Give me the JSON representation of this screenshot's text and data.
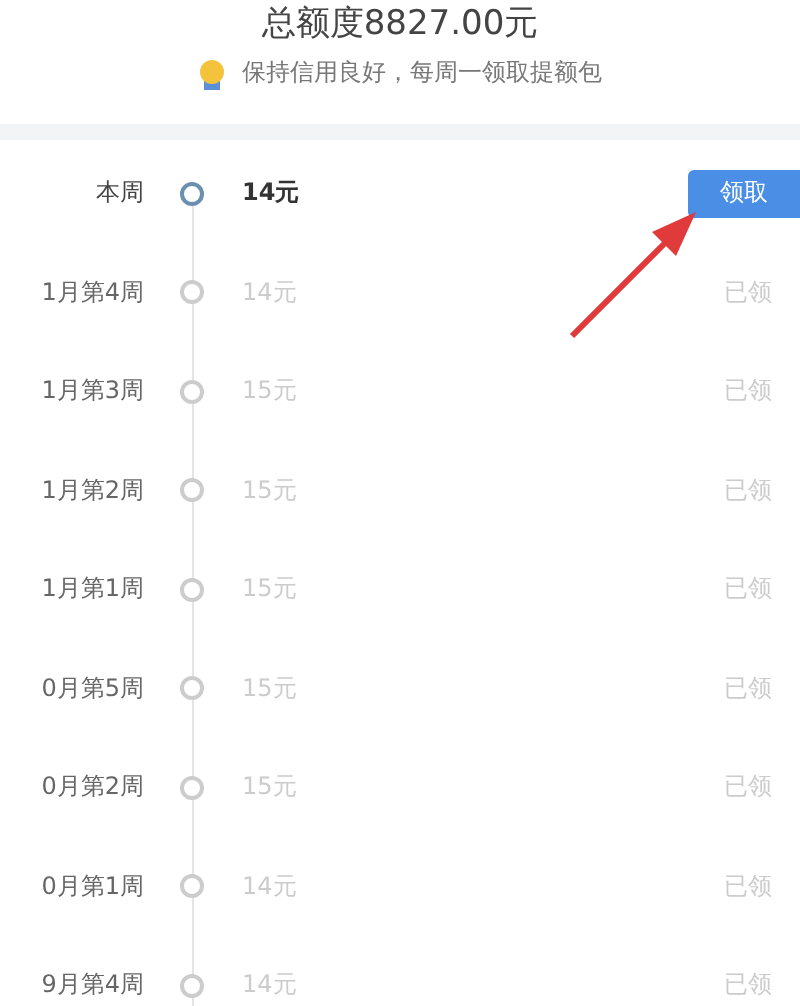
{
  "header": {
    "total": "总额度8827.00元",
    "tip": "保持信用良好，每周一领取提额包"
  },
  "weeks": [
    {
      "kind": "current",
      "week": "本周",
      "amount": "14元",
      "action": "领取"
    },
    {
      "kind": "claimed",
      "week": "1月第4周",
      "amount": "14元",
      "action": "已领"
    },
    {
      "kind": "claimed",
      "week": "1月第3周",
      "amount": "15元",
      "action": "已领"
    },
    {
      "kind": "claimed",
      "week": "1月第2周",
      "amount": "15元",
      "action": "已领"
    },
    {
      "kind": "claimed",
      "week": "1月第1周",
      "amount": "15元",
      "action": "已领"
    },
    {
      "kind": "claimed",
      "week": "0月第5周",
      "amount": "15元",
      "action": "已领"
    },
    {
      "kind": "claimed",
      "week": "0月第2周",
      "amount": "15元",
      "action": "已领"
    },
    {
      "kind": "claimed",
      "week": "0月第1周",
      "amount": "14元",
      "action": "已领"
    },
    {
      "kind": "claimed",
      "week": "9月第4周",
      "amount": "14元",
      "action": "已领"
    }
  ]
}
